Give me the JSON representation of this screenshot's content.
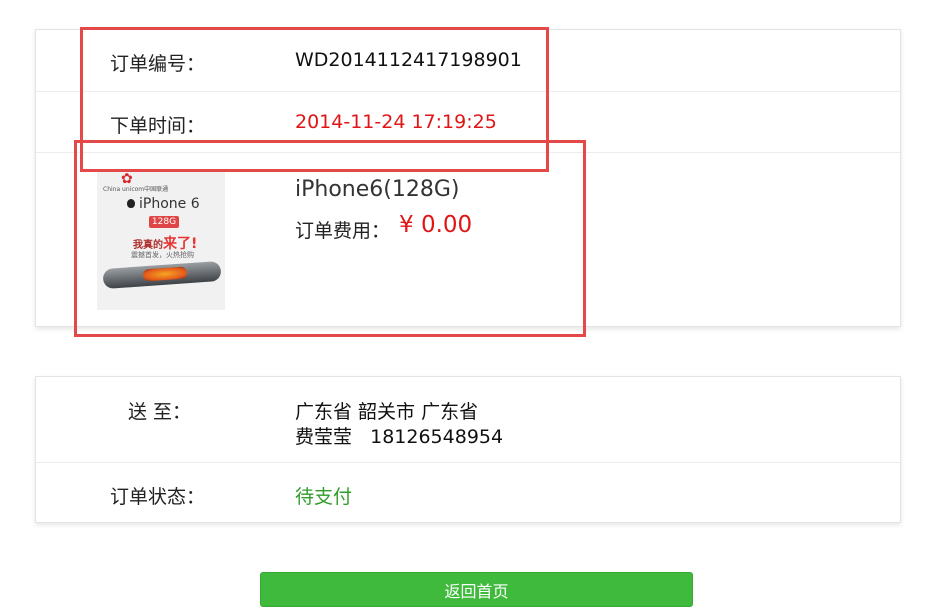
{
  "order": {
    "number_label": "订单编号：",
    "number": "WD2014112417198901",
    "time_label": "下单时间：",
    "time": "2014-11-24 17:19:25",
    "product": {
      "name": "iPhone6(128G)",
      "fee_label": "订单费用：",
      "fee": "¥ 0.00",
      "image": {
        "brand_text": "China unicom中国联通",
        "model": "iPhone 6",
        "capacity": "128G",
        "promo_prefix": "我真的",
        "promo_highlight": "来了!",
        "promo_sub": "震撼首发，火热抢购"
      }
    }
  },
  "delivery": {
    "ship_label": "送 至：",
    "address": "广东省 韶关市 广东省",
    "recipient": "费莹莹   18126548954",
    "status_label": "订单状态：",
    "status": "待支付"
  },
  "actions": {
    "home_button": "返回首页"
  },
  "colors": {
    "time": "#e11515",
    "fee": "#e11515",
    "status": "#2f9d2a",
    "button": "#3fba3c",
    "highlight": "#e54848"
  }
}
